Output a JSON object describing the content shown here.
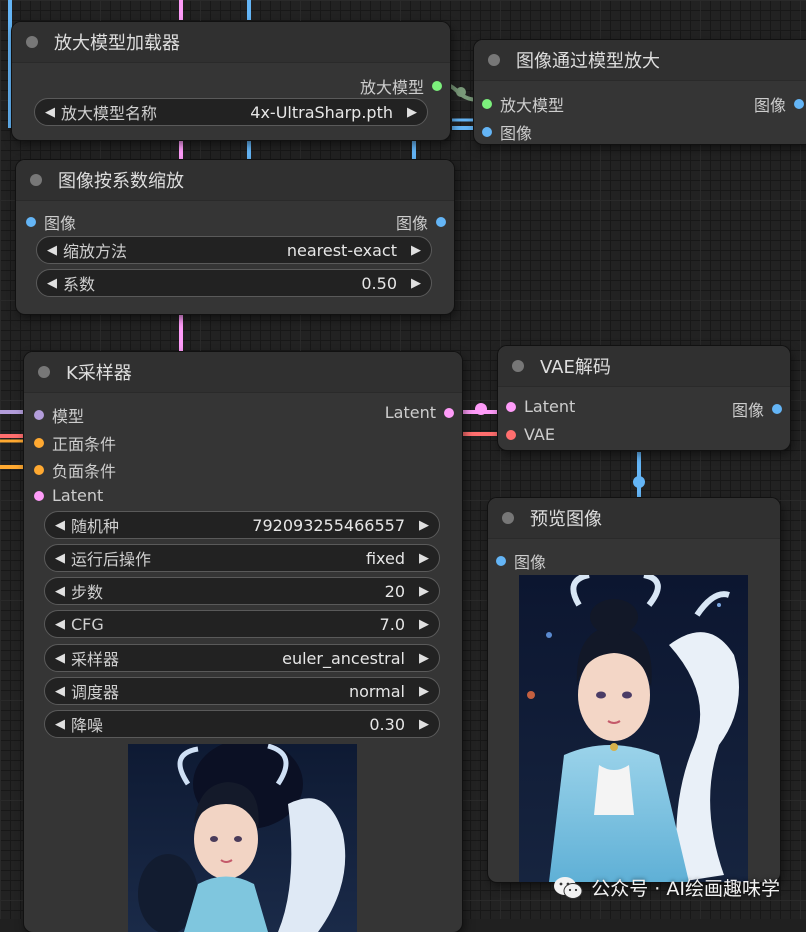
{
  "nodes": {
    "upscale_loader": {
      "title": "放大模型加载器",
      "output": "放大模型",
      "widget": {
        "label": "放大模型名称",
        "value": "4x-UltraSharp.pth"
      }
    },
    "upscale_with_model": {
      "title": "图像通过模型放大",
      "inputs": [
        "放大模型",
        "图像"
      ],
      "output": "图像"
    },
    "scale_by": {
      "title": "图像按系数缩放",
      "input": "图像",
      "output": "图像",
      "widgets": [
        {
          "label": "缩放方法",
          "value": "nearest-exact"
        },
        {
          "label": "系数",
          "value": "0.50"
        }
      ]
    },
    "ksampler": {
      "title": "K采样器",
      "inputs": [
        "模型",
        "正面条件",
        "负面条件",
        "Latent"
      ],
      "output": "Latent",
      "widgets": [
        {
          "label": "随机种",
          "value": "792093255466557"
        },
        {
          "label": "运行后操作",
          "value": "fixed"
        },
        {
          "label": "步数",
          "value": "20"
        },
        {
          "label": "CFG",
          "value": "7.0"
        },
        {
          "label": "采样器",
          "value": "euler_ancestral"
        },
        {
          "label": "调度器",
          "value": "normal"
        },
        {
          "label": "降噪",
          "value": "0.30"
        }
      ]
    },
    "vae_decode": {
      "title": "VAE解码",
      "inputs": [
        "Latent",
        "VAE"
      ],
      "output": "图像"
    },
    "preview": {
      "title": "预览图像",
      "input": "图像"
    }
  },
  "arrows": {
    "left": "◀",
    "right": "▶"
  },
  "watermark": "公众号 · AI绘画趣味学",
  "colors": {
    "model": "#b39ddb",
    "conditioning": "#ffa931",
    "latent": "#ff9cf9",
    "vae": "#ff6e6e",
    "image": "#64b5f6",
    "upscale_model": "#7cf07c"
  }
}
